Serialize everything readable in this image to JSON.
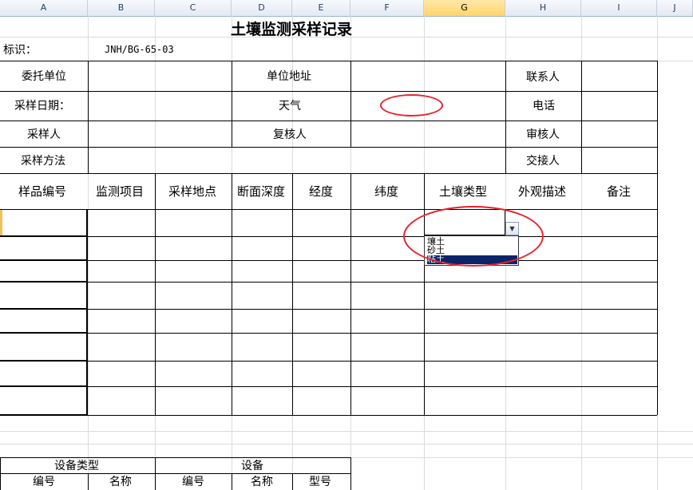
{
  "column_headers": [
    "A",
    "B",
    "C",
    "D",
    "E",
    "F",
    "G",
    "H",
    "I",
    "J"
  ],
  "selected_column": "G",
  "form": {
    "title": "土壤监测采样记录",
    "id_label": "标识：",
    "id_value": "JNH/BG-65-03",
    "info_rows": {
      "client_unit": "委托单位",
      "unit_address": "单位地址",
      "contact": "联系人",
      "sampling_date": "采样日期：",
      "weather": "天气",
      "phone": "电话",
      "sampler": "采样人",
      "rechecker": "复核人",
      "reviewer": "审核人",
      "sampling_method": "采样方法",
      "handover": "交接人"
    },
    "sample_table_headers": [
      "样品编号",
      "监测项目",
      "采样地点",
      "断面深度",
      "经度",
      "纬度",
      "土壤类型",
      "外观描述",
      "备注"
    ],
    "soil_type_dropdown": {
      "options": [
        "壤土",
        "砂土",
        "粘土"
      ],
      "selected": "粘土"
    },
    "equipment_table": {
      "type_header": "设备类型",
      "equipment_header": "设备",
      "sub_headers": [
        "编号",
        "名称",
        "编号",
        "名称",
        "型号"
      ]
    }
  },
  "colors": {
    "highlight_ellipse": "#e8232a",
    "selected_option_bg": "#0a246a",
    "grid_line": "#dadcdd"
  }
}
